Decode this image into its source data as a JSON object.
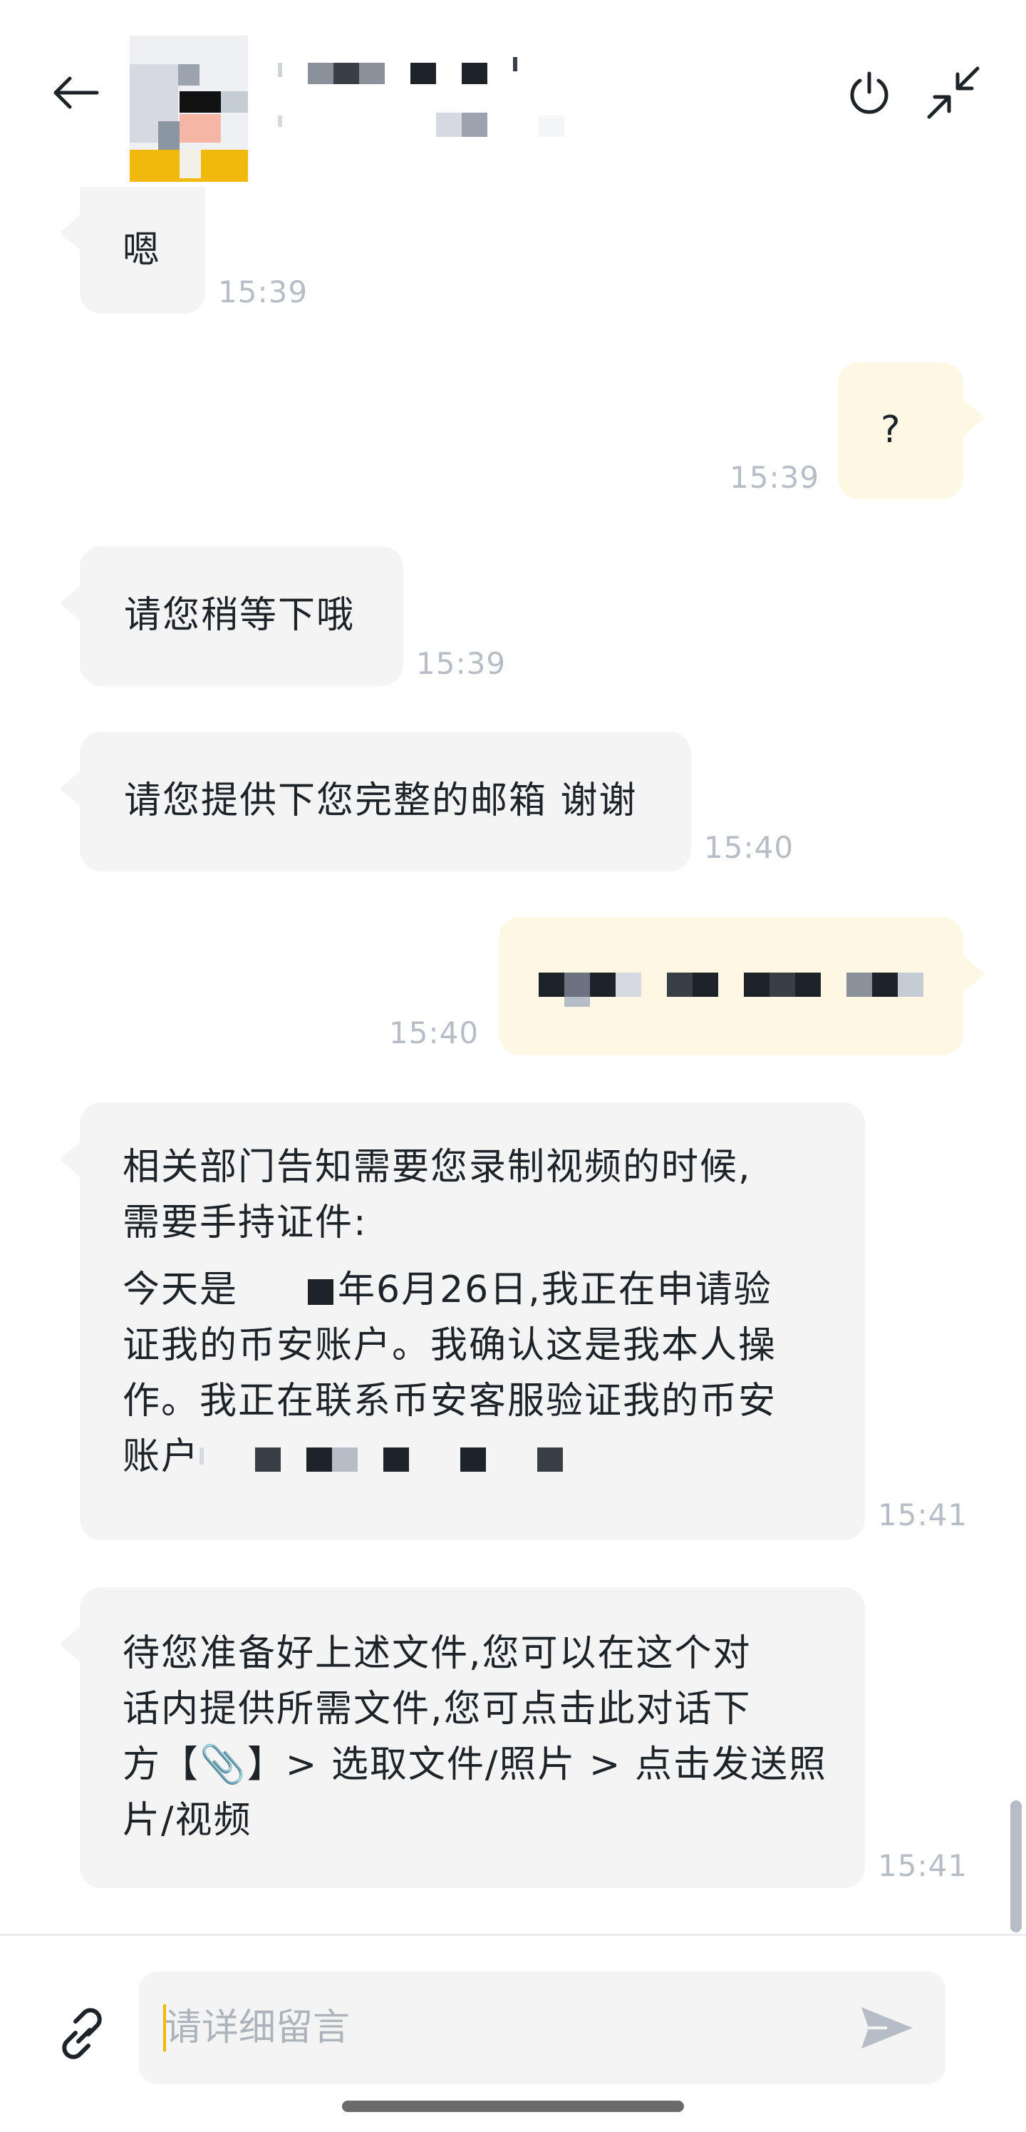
{
  "header": {
    "back_icon": "arrow-left-icon",
    "power_icon": "power-icon",
    "minimize_icon": "collapse-arrows-icon"
  },
  "messages": [
    {
      "side": "in",
      "text": "嗯",
      "time": "15:39"
    },
    {
      "side": "out",
      "text": "?",
      "time": "15:39"
    },
    {
      "side": "in",
      "text": "请您稍等下哦",
      "time": "15:39"
    },
    {
      "side": "in",
      "text": "请您提供下您完整的邮箱 谢谢",
      "time": "15:40"
    },
    {
      "side": "out",
      "text": "",
      "time": "15:40",
      "redacted": true
    },
    {
      "side": "in",
      "time": "15:41",
      "para1_line1": "相关部门告知需要您录制视频的时候,",
      "para1_line2": "需要手持证件:",
      "para2_line1_a": "今天是",
      "para2_line1_b": "年6月26日,我正在申请验",
      "para2_line2": "证我的币安账户。我确认这是我本人操",
      "para2_line3": "作。我正在联系币安客服验证我的币安",
      "para2_line4": "账户"
    },
    {
      "side": "in",
      "time": "15:41",
      "line1": "待您准备好上述文件,您可以在这个对",
      "line2": "话内提供所需文件,您可点击此对话下",
      "line3": "方【📎】> 选取文件/照片 > 点击发送照",
      "line4": "片/视频"
    }
  ],
  "composer": {
    "attach_icon": "link-icon",
    "placeholder": "请详细留言",
    "send_icon": "send-icon"
  },
  "colors": {
    "incoming_bubble": "#f4f4f4",
    "outgoing_bubble": "#fdf8e4",
    "timestamp": "#b7bdc6",
    "caret": "#f0b90b"
  }
}
